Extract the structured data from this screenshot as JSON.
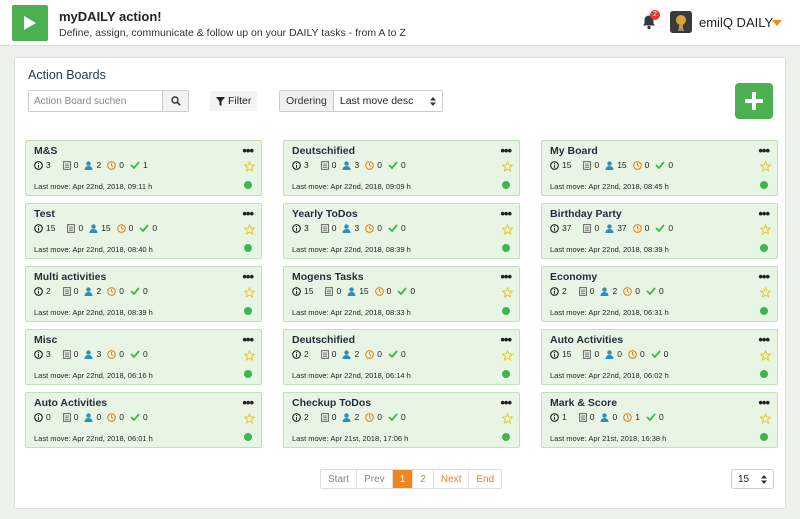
{
  "header": {
    "title": "myDAILY action!",
    "subtitle": "Define, assign, communicate & follow up on your DAILY tasks - from A to Z",
    "notification_count": "2",
    "user_name": "emilQ DAILY"
  },
  "panel": {
    "title": "Action Boards",
    "search_placeholder": "Action Board suchen",
    "filter_label": "Filter",
    "ordering_label": "Ordering",
    "ordering_value": "Last move desc"
  },
  "colors": {
    "brand_green": "#4caf50",
    "accent_orange": "#f0861c",
    "card_bg": "#e9f5e4",
    "status_dot": "#3fb64a"
  },
  "boards": [
    {
      "title": "M&S",
      "info": "3",
      "docs": "0",
      "users": "2",
      "time": "0",
      "done": "1",
      "last_move": "Last move: Apr 22nd, 2018, 09:11 h"
    },
    {
      "title": "Deutschified",
      "info": "3",
      "docs": "0",
      "users": "3",
      "time": "0",
      "done": "0",
      "last_move": "Last move: Apr 22nd, 2018, 09:09 h"
    },
    {
      "title": "My Board",
      "info": "15",
      "docs": "0",
      "users": "15",
      "time": "0",
      "done": "0",
      "last_move": "Last move: Apr 22nd, 2018, 08:45 h"
    },
    {
      "title": "Test",
      "info": "15",
      "docs": "0",
      "users": "15",
      "time": "0",
      "done": "0",
      "last_move": "Last move: Apr 22nd, 2018, 08:40 h"
    },
    {
      "title": "Yearly ToDos",
      "info": "3",
      "docs": "0",
      "users": "3",
      "time": "0",
      "done": "0",
      "last_move": "Last move: Apr 22nd, 2018, 08:39 h"
    },
    {
      "title": "Birthday Party",
      "info": "37",
      "docs": "0",
      "users": "37",
      "time": "0",
      "done": "0",
      "last_move": "Last move: Apr 22nd, 2018, 08:39 h"
    },
    {
      "title": "Multi activities",
      "info": "2",
      "docs": "0",
      "users": "2",
      "time": "0",
      "done": "0",
      "last_move": "Last move: Apr 22nd, 2018, 08:39 h"
    },
    {
      "title": "Mogens Tasks",
      "info": "15",
      "docs": "0",
      "users": "15",
      "time": "0",
      "done": "0",
      "last_move": "Last move: Apr 22nd, 2018, 08:33 h"
    },
    {
      "title": "Economy",
      "info": "2",
      "docs": "0",
      "users": "2",
      "time": "0",
      "done": "0",
      "last_move": "Last move: Apr 22nd, 2018, 06:31 h"
    },
    {
      "title": "Misc",
      "info": "3",
      "docs": "0",
      "users": "3",
      "time": "0",
      "done": "0",
      "last_move": "Last move: Apr 22nd, 2018, 06:16 h"
    },
    {
      "title": "Deutschified",
      "info": "2",
      "docs": "0",
      "users": "2",
      "time": "0",
      "done": "0",
      "last_move": "Last move: Apr 22nd, 2018, 06:14 h"
    },
    {
      "title": "Auto Activities",
      "info": "15",
      "docs": "0",
      "users": "0",
      "time": "0",
      "done": "0",
      "last_move": "Last move: Apr 22nd, 2018, 06:02 h"
    },
    {
      "title": "Auto Activities",
      "info": "0",
      "docs": "0",
      "users": "0",
      "time": "0",
      "done": "0",
      "last_move": "Last move: Apr 22nd, 2018, 06:01 h"
    },
    {
      "title": "Checkup ToDos",
      "info": "2",
      "docs": "0",
      "users": "2",
      "time": "0",
      "done": "0",
      "last_move": "Last move: Apr 21st, 2018, 17:06 h"
    },
    {
      "title": "Mark & Score",
      "info": "1",
      "docs": "0",
      "users": "0",
      "time": "1",
      "done": "0",
      "last_move": "Last move: Apr 21st, 2018, 16:38 h"
    }
  ],
  "pagination": {
    "start": "Start",
    "prev": "Prev",
    "page1": "1",
    "page2": "2",
    "next": "Next",
    "end": "End",
    "per_page": "15"
  }
}
